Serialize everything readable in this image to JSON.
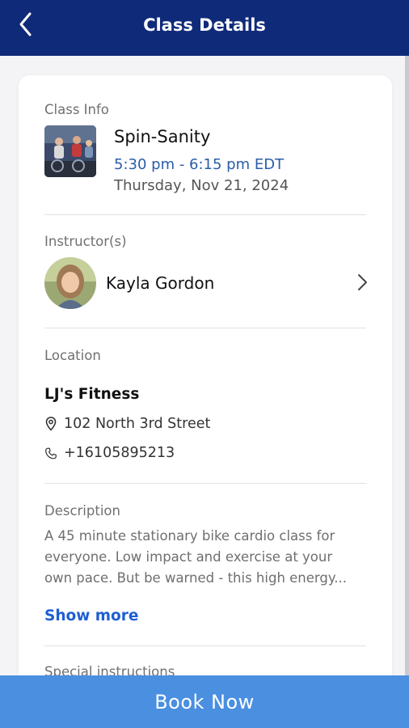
{
  "header": {
    "title": "Class Details",
    "back_icon": "chevron-left-icon"
  },
  "class_info": {
    "label": "Class Info",
    "name": "Spin-Sanity",
    "time": "5:30 pm - 6:15 pm EDT",
    "date": "Thursday, Nov 21, 2024"
  },
  "instructors": {
    "label": "Instructor(s)",
    "name": "Kayla Gordon",
    "chevron_icon": "chevron-right-icon"
  },
  "location": {
    "label": "Location",
    "name": "LJ's Fitness",
    "address": "102 North 3rd Street",
    "phone": "+16105895213",
    "address_icon": "map-pin-icon",
    "phone_icon": "phone-icon"
  },
  "description": {
    "label": "Description",
    "text": "A 45 minute stationary bike cardio class for everyone. Low impact and exercise at your own pace. But be warned - this high energy...",
    "show_more": "Show more"
  },
  "special_instructions": {
    "label": "Special instructions"
  },
  "footer": {
    "book_label": "Book Now"
  },
  "colors": {
    "header_bg": "#102a7a",
    "accent_blue": "#2a5da8",
    "link_blue": "#1f5fd1",
    "book_button_bg": "#4a8fe0"
  }
}
